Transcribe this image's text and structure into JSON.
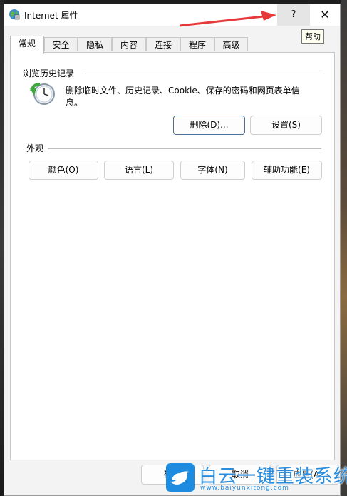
{
  "window": {
    "title": "Internet 属性",
    "help_label": "?",
    "close_label": "✕",
    "tooltip": "帮助"
  },
  "tabs": [
    {
      "label": "常规",
      "active": true
    },
    {
      "label": "安全"
    },
    {
      "label": "隐私"
    },
    {
      "label": "内容"
    },
    {
      "label": "连接"
    },
    {
      "label": "程序"
    },
    {
      "label": "高级"
    }
  ],
  "browsing_history": {
    "heading": "浏览历史记录",
    "description": "删除临时文件、历史记录、Cookie、保存的密码和网页表单信息。",
    "delete_button": "删除(D)...",
    "settings_button": "设置(S)"
  },
  "appearance": {
    "heading": "外观",
    "buttons": [
      "颜色(O)",
      "语言(L)",
      "字体(N)",
      "辅助功能(E)"
    ]
  },
  "bottom_buttons": {
    "ok": "确定",
    "cancel": "取消",
    "apply": "应用(A)"
  },
  "watermark": {
    "title": "白云一键重装系统",
    "url": "www.baiyunxitong.com"
  },
  "colors": {
    "accent": "#1d8ce0",
    "arrow": "#e8393a"
  }
}
